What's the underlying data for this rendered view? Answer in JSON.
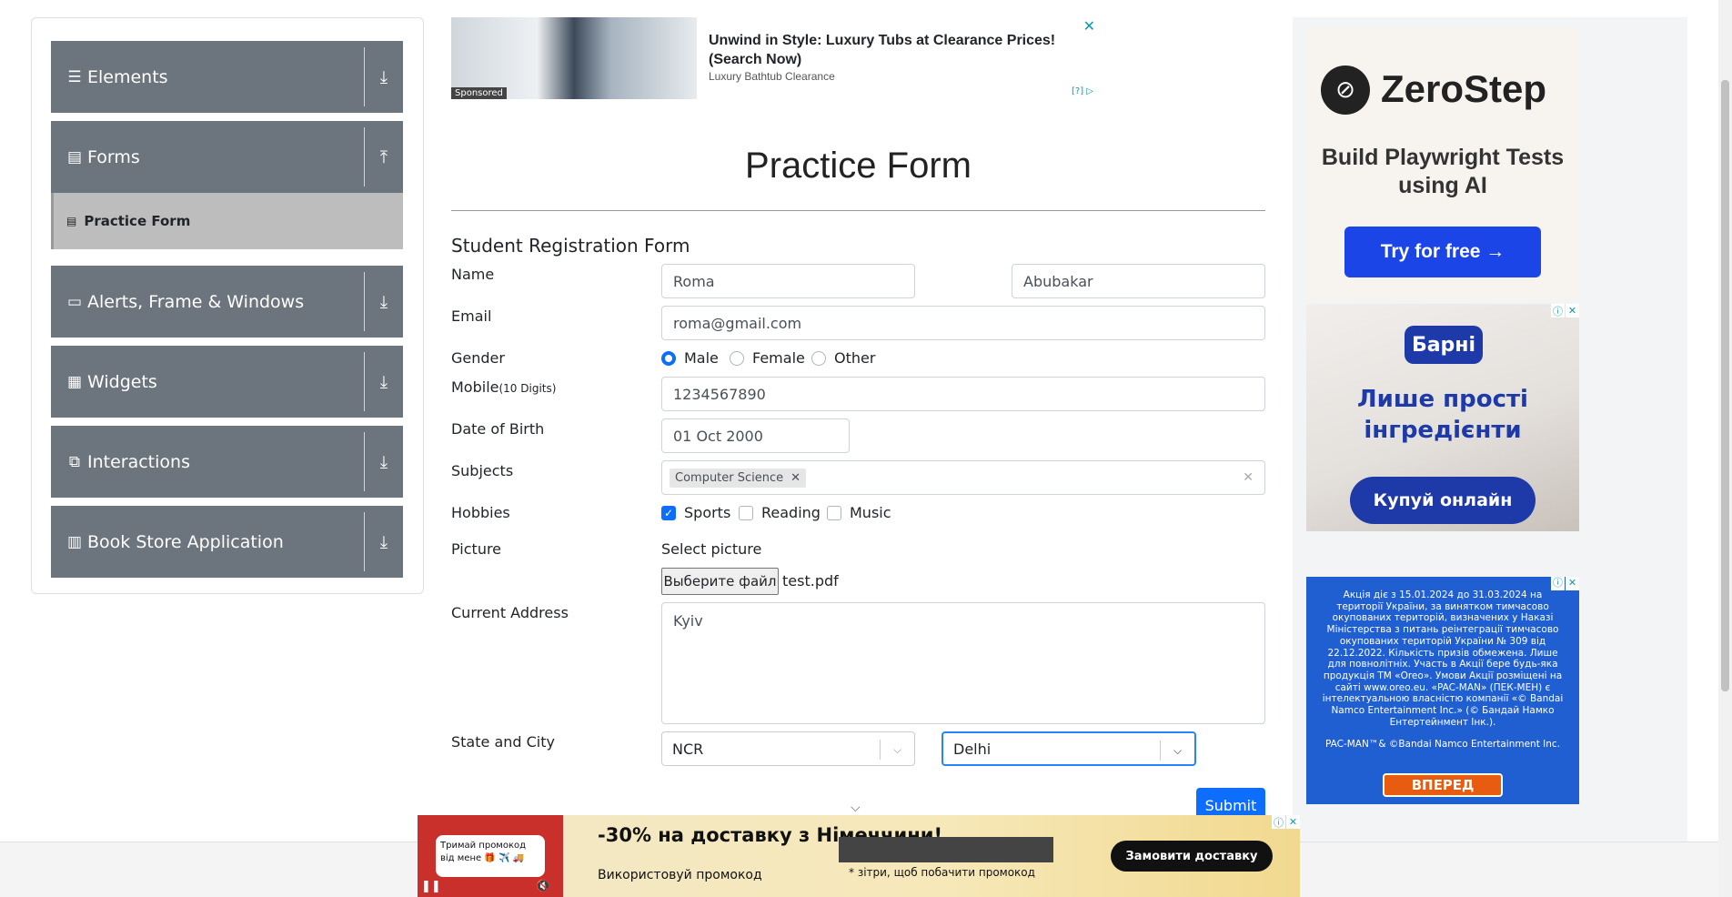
{
  "sidebar": {
    "groups": [
      {
        "label": "Elements",
        "icon": "hamburger-icon",
        "arrow": "⤓"
      },
      {
        "label": "Forms",
        "icon": "document-icon",
        "arrow": "⤒"
      },
      {
        "label": "Alerts, Frame & Windows",
        "icon": "window-icon",
        "arrow": "⤓"
      },
      {
        "label": "Widgets",
        "icon": "grid-icon",
        "arrow": "⤓"
      },
      {
        "label": "Interactions",
        "icon": "interaction-icon",
        "arrow": "⤓"
      },
      {
        "label": "Book Store Application",
        "icon": "books-icon",
        "arrow": "⤓"
      }
    ],
    "active_sub": "Practice Form"
  },
  "top_ad": {
    "headline": "Unwind in Style: Luxury Tubs at Clearance Prices! (Search Now)",
    "source": "Luxury Bathtub Clearance",
    "sponsored": "Sponsored",
    "info": "[?]"
  },
  "page": {
    "title": "Practice Form",
    "form_title": "Student Registration Form"
  },
  "form": {
    "name_label": "Name",
    "first_name": "Roma",
    "last_name": "Abubakar",
    "email_label": "Email",
    "email": "roma@gmail.com",
    "gender_label": "Gender",
    "gender_options": [
      "Male",
      "Female",
      "Other"
    ],
    "gender_selected": "Male",
    "mobile_label": "Mobile",
    "mobile_hint": "(10 Digits)",
    "mobile": "1234567890",
    "dob_label": "Date of Birth",
    "dob": "01 Oct 2000",
    "subjects_label": "Subjects",
    "subjects": [
      "Computer Science"
    ],
    "hobbies_label": "Hobbies",
    "hobbies": [
      "Sports",
      "Reading",
      "Music"
    ],
    "hobbies_checked": [
      "Sports"
    ],
    "picture_label": "Picture",
    "select_picture": "Select picture",
    "file_button": "Выберите файл",
    "file_name": "test.pdf",
    "address_label": "Current Address",
    "address": "Kyiv",
    "state_city_label": "State and City",
    "state": "NCR",
    "city": "Delhi",
    "submit": "Submit"
  },
  "right_ads": {
    "zerostep": {
      "brand": "ZeroStep",
      "tagline": "Build Playwright Tests using AI",
      "cta": "Try for free →"
    },
    "barni": {
      "brand": "Барні",
      "text": "Лише прості інгредієнти",
      "cta": "Купуй онлайн"
    },
    "oreo": {
      "text": "Акція діє з 15.01.2024 до 31.03.2024 на території України, за винятком тимчасово окупованих територій, визначених у Наказі Міністерства з питань реінтеграції тимчасово окупованих територій України № 309 від 22.12.2022. Кількість призів обмежена. Лише для повнолітніх. Участь в Акції бере будь-яка продукція ТМ «Oreo». Умови Акції розміщені на сайті www.oreo.eu. «PAC-MAN» (ПЕК-МЕН) є інтелектуальною власністю компанії «© Bandai Namco Entertainment Inc.» (© Бандай Намко Ентертейнмент Інк.).",
      "footer": "PAC-MAN™& ©Bandai Namco Entertainment Inc.",
      "cta": "ВПЕРЕД"
    }
  },
  "bottom_ad": {
    "bubble": "Тримай промокод від мене 🎁 ✈️ 🚚",
    "headline": "-30% на доставку з Німеччини!",
    "sub": "Використовуй промокод",
    "hint": "* зітри, щоб побачити промокод",
    "cta": "Замовити доставку"
  },
  "colors": {
    "accent": "#0d6efd",
    "sidebar": "#6c757d"
  }
}
